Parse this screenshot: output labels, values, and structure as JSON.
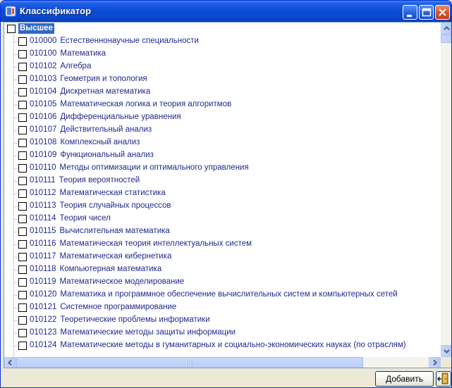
{
  "window": {
    "title": "Классификатор",
    "colors": {
      "title_bar": "#0A4DD6",
      "selection": "#316AC5",
      "node_text": "#1F2A8C"
    }
  },
  "tree": {
    "root": {
      "label": "Высшее",
      "selected": true,
      "checked": false
    },
    "items": [
      {
        "code": "010000",
        "name": "Естественнонаучные специальности"
      },
      {
        "code": "010100",
        "name": "Математика"
      },
      {
        "code": "010102",
        "name": "Алгебра"
      },
      {
        "code": "010103",
        "name": "Геометрия и топология"
      },
      {
        "code": "010104",
        "name": "Дискретная математика"
      },
      {
        "code": "010105",
        "name": "Математическая логика и теория алгоритмов"
      },
      {
        "code": "010106",
        "name": "Дифференциальные уравнения"
      },
      {
        "code": "010107",
        "name": "Действительный анализ"
      },
      {
        "code": "010108",
        "name": "Комплексный анализ"
      },
      {
        "code": "010109",
        "name": "Функциональный анализ"
      },
      {
        "code": "010110",
        "name": "Методы оптимизации и оптимального управления"
      },
      {
        "code": "010111",
        "name": "Теория вероятностей"
      },
      {
        "code": "010112",
        "name": "Математическая статистика"
      },
      {
        "code": "010113",
        "name": "Теория случайных процессов"
      },
      {
        "code": "010114",
        "name": "Теория чисел"
      },
      {
        "code": "010115",
        "name": "Вычислительная математика"
      },
      {
        "code": "010116",
        "name": "Математическая теория интеллектуальных систем"
      },
      {
        "code": "010117",
        "name": "Математическая кибернетика"
      },
      {
        "code": "010118",
        "name": "Компьютерная математика"
      },
      {
        "code": "010119",
        "name": "Математическое моделирование"
      },
      {
        "code": "010120",
        "name": "Математика и программное обеспечение вычислительных систем и компьютерных сетей"
      },
      {
        "code": "010121",
        "name": "Системное программирование"
      },
      {
        "code": "010122",
        "name": "Теоретические проблемы информатики"
      },
      {
        "code": "010123",
        "name": "Математические методы защиты информации"
      },
      {
        "code": "010124",
        "name": "Математические методы в гуманитарных и социально-экономических науках (по отраслям)"
      }
    ]
  },
  "buttons": {
    "add_label": "Добавить",
    "exit_icon": "exit-door-icon"
  },
  "icons": {
    "app": "app-window-icon",
    "minimize": "minimize-icon",
    "maximize": "maximize-icon",
    "close": "close-icon",
    "scroll_up": "arrow-up-icon",
    "scroll_down": "arrow-down-icon",
    "scroll_left": "arrow-left-icon",
    "scroll_right": "arrow-right-icon"
  }
}
